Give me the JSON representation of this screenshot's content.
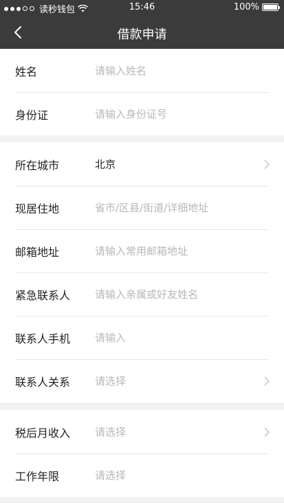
{
  "status_bar": {
    "carrier": "读秒钱包",
    "time": "15:46",
    "battery": "100%"
  },
  "nav": {
    "title": "借款申请"
  },
  "sections": [
    {
      "rows": [
        {
          "label": "姓名",
          "value": "请输入姓名",
          "placeholder": true
        },
        {
          "label": "身份证",
          "value": "请输入身份证号",
          "placeholder": true
        }
      ]
    },
    {
      "rows": [
        {
          "label": "所在城市",
          "value": "北京",
          "placeholder": false,
          "chevron": true
        },
        {
          "label": "现居住地",
          "value": "省市/区县/街道/详细地址",
          "placeholder": true
        },
        {
          "label": "邮箱地址",
          "value": "请输入常用邮箱地址",
          "placeholder": true
        },
        {
          "label": "紧急联系人",
          "value": "请输入亲属或好友姓名",
          "placeholder": true
        },
        {
          "label": "联系人手机",
          "value": "请输入",
          "placeholder": true
        },
        {
          "label": "联系人关系",
          "value": "请选择",
          "placeholder": true,
          "chevron": true
        }
      ]
    },
    {
      "rows": [
        {
          "label": "税后月收入",
          "value": "请选择",
          "placeholder": true,
          "chevron": true
        },
        {
          "label": "工作年限",
          "value": "请选择",
          "placeholder": true
        }
      ]
    }
  ],
  "colors": {
    "header_bg": "#3b3b3b",
    "page_bg": "#f2f2f2",
    "placeholder": "#b8b8b8",
    "text": "#222222"
  }
}
